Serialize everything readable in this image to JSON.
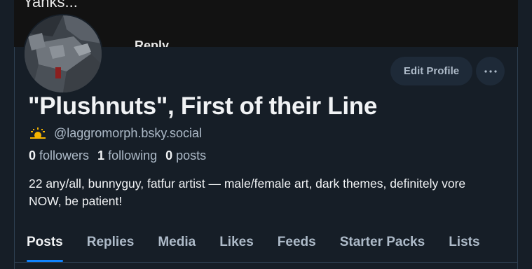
{
  "banner": {
    "text": "Yanks...",
    "reply_label": "Reply"
  },
  "profile": {
    "display_name": "\"Plushnuts\", First of their Line",
    "handle": "@laggromorph.bsky.social",
    "stats": [
      {
        "count": "0",
        "label": "followers"
      },
      {
        "count": "1",
        "label": "following"
      },
      {
        "count": "0",
        "label": "posts"
      }
    ],
    "bio": "22 any/all, bunnyguy, fatfur artist — male/female art, dark themes, definitely vore NOW, be patient!"
  },
  "actions": {
    "edit_label": "Edit Profile",
    "more_icon": "ellipsis-icon"
  },
  "tabs": [
    {
      "label": "Posts",
      "active": true
    },
    {
      "label": "Replies"
    },
    {
      "label": "Media"
    },
    {
      "label": "Likes"
    },
    {
      "label": "Feeds"
    },
    {
      "label": "Starter Packs"
    },
    {
      "label": "Lists"
    }
  ],
  "colors": {
    "accent": "#1083fe",
    "background": "#161e27",
    "muted": "#aebbc9",
    "sun_badge": "#f5b400"
  }
}
